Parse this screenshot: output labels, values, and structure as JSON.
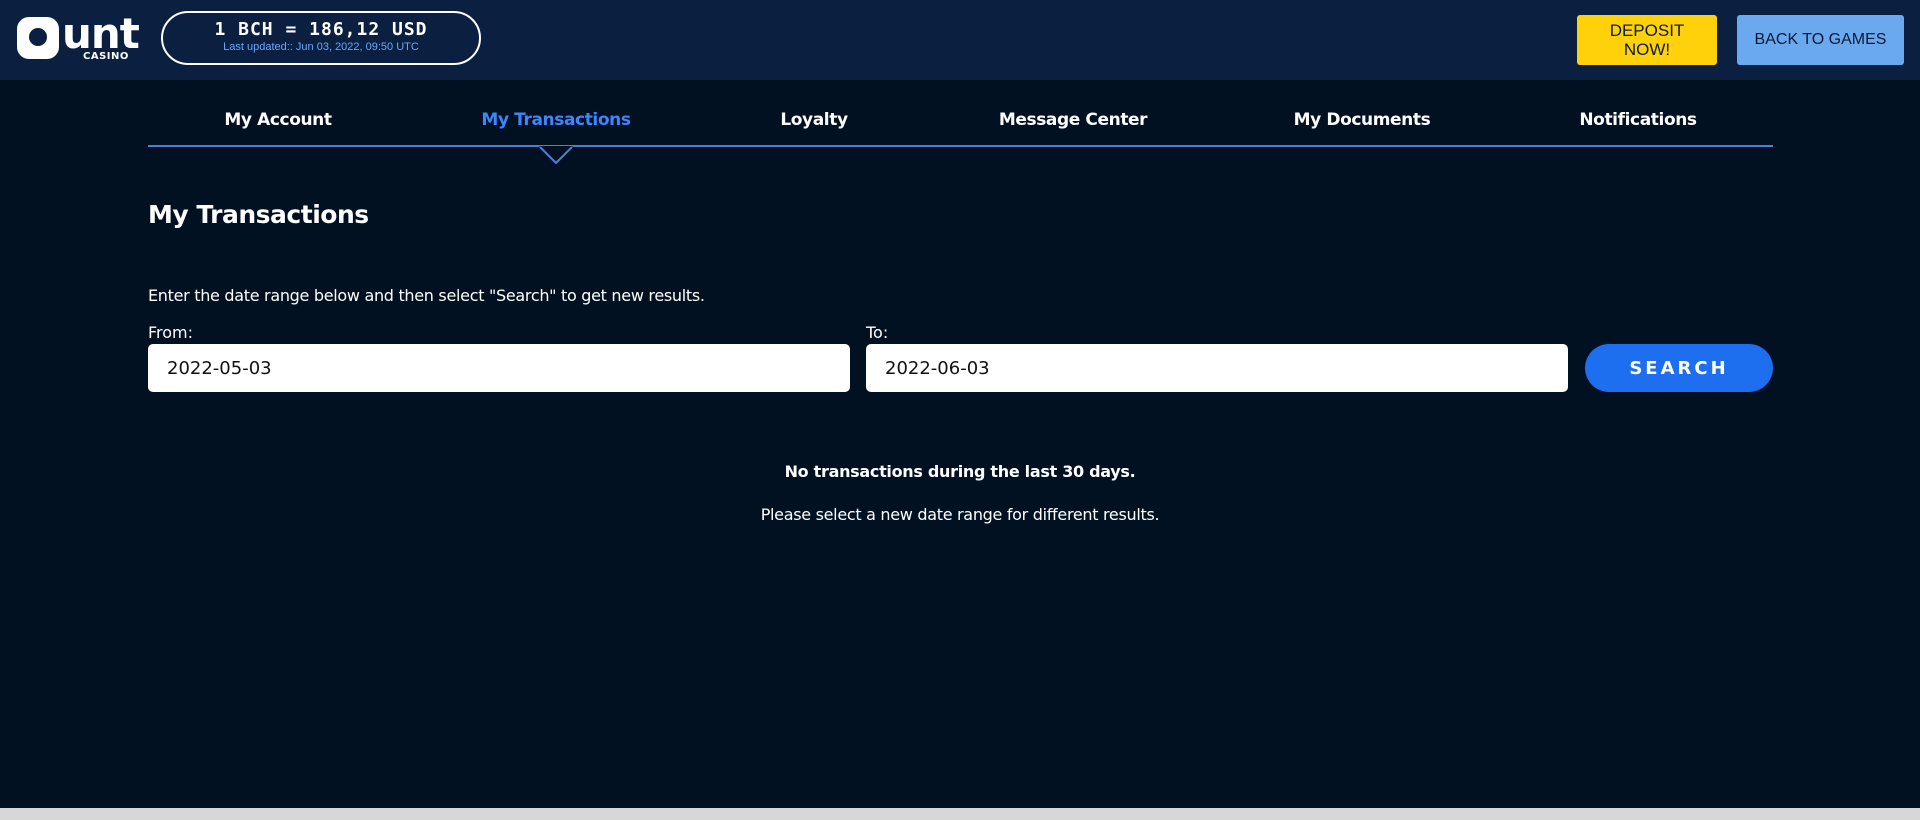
{
  "brand": {
    "logo_text": "unt",
    "logo_subtext": "CASINO"
  },
  "header": {
    "rate_text": "1 BCH = 186,12 USD",
    "rate_updated": "Last updated:: Jun 03, 2022, 09:50 UTC",
    "deposit_line1": "DEPOSIT",
    "deposit_line2": "NOW!",
    "back_label": "BACK TO GAMES"
  },
  "tabs": [
    {
      "label": "My Account",
      "active": false
    },
    {
      "label": "My Transactions",
      "active": true
    },
    {
      "label": "Loyalty",
      "active": false
    },
    {
      "label": "Message Center",
      "active": false
    },
    {
      "label": "My Documents",
      "active": false
    },
    {
      "label": "Notifications",
      "active": false
    }
  ],
  "main": {
    "title": "My Transactions",
    "instructions": "Enter the date range below and then select \"Search\" to get new results.",
    "from_label": "From:",
    "from_value": "2022-05-03",
    "to_label": "To:",
    "to_value": "2022-06-03",
    "search_label": "SEARCH",
    "empty_title": "No transactions during the last 30 days.",
    "empty_subtitle": "Please select a new date range for different results."
  },
  "colors": {
    "page_bg": "#011122",
    "header_bg": "#0b2040",
    "deposit_bg": "#ffd10a",
    "back_bg": "#6aa8ef",
    "active_tab": "#3d86ff",
    "search_bg": "#1e6ff0"
  }
}
